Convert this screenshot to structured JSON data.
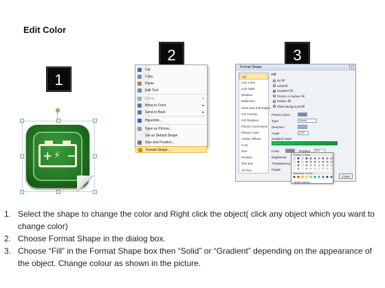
{
  "title": "Edit Color",
  "steps": [
    "1",
    "2",
    "3"
  ],
  "context_menu": {
    "items": [
      {
        "label": "Cut",
        "icon": "scissors-icon",
        "color": "#4a6fa5"
      },
      {
        "label": "Copy",
        "icon": "copy-icon",
        "color": "#6a8cc0"
      },
      {
        "label": "Paste",
        "icon": "paste-icon",
        "color": "#b08a3c"
      },
      {
        "label": "Edit Text",
        "icon": "edit-text-icon",
        "color": "#7788aa"
      },
      {
        "label": "Group",
        "icon": "group-icon",
        "color": "#aaaaaa",
        "disabled": true,
        "submenu": true
      },
      {
        "label": "Bring to Front",
        "icon": "bring-front-icon",
        "color": "#5577aa",
        "submenu": true
      },
      {
        "label": "Send to Back",
        "icon": "send-back-icon",
        "color": "#5577aa",
        "submenu": true
      },
      {
        "label": "Hyperlink...",
        "icon": "hyperlink-icon",
        "color": "#3366cc"
      },
      {
        "label": "Save as Picture...",
        "icon": "save-picture-icon",
        "color": "#999999"
      },
      {
        "label": "Set as Default Shape",
        "icon": "",
        "color": ""
      },
      {
        "label": "Size and Position...",
        "icon": "size-position-icon",
        "color": "#6677aa"
      },
      {
        "label": "Format Shape...",
        "icon": "format-shape-icon",
        "color": "#cc8833",
        "highlighted": true
      }
    ]
  },
  "dialog": {
    "title": "Format Shape",
    "close": "x",
    "categories": [
      "Fill",
      "Line Color",
      "Line Style",
      "Shadow",
      "Reflection",
      "Glow and Soft Edges",
      "3-D Format",
      "3-D Rotation",
      "Picture Corrections",
      "Picture Color",
      "Artistic Effects",
      "Crop",
      "Size",
      "Position",
      "Text Box",
      "Alt Text"
    ],
    "section": "Fill",
    "options": [
      "No fill",
      "Solid fill",
      "Gradient fill",
      "Picture or texture fill",
      "Pattern fill",
      "Slide background fill"
    ],
    "selected_option": "Gradient fill",
    "fields": {
      "preset": "Preset colors:",
      "type": "Type:",
      "type_value": "Linear",
      "direction": "Direction:",
      "angle": "Angle:",
      "angle_value": "270°",
      "stops": "Gradient stops",
      "color": "Color:",
      "position": "Position:",
      "position_value": "0%",
      "brightness": "Brightness:",
      "transparency": "Transparency:",
      "rotate": "Rotate"
    },
    "palette": {
      "theme_label": "Theme Colors",
      "standard_label": "Standard Colors",
      "more": "More Colors...",
      "theme": [
        "#ffffff",
        "#000000",
        "#eeece1",
        "#1f497d",
        "#4f81bd",
        "#c0504d",
        "#9bbb59",
        "#8064a2",
        "#4bacc6",
        "#f79646"
      ],
      "standard": [
        "#c00000",
        "#ff0000",
        "#ffc000",
        "#ffff00",
        "#92d050",
        "#00b050",
        "#00b0f0",
        "#0070c0",
        "#002060",
        "#7030a0"
      ]
    },
    "close_button": "Close"
  },
  "shape": {
    "accent": "#1d6b1d",
    "icon": "battery-icon",
    "plus": "+",
    "bolt": "⚡",
    "minus": "−"
  },
  "instructions": [
    {
      "n": "1.",
      "text": "Select the shape to change the color and Right click the object( click any object which you want to change color)"
    },
    {
      "n": "2.",
      "text": "Choose Format Shape in the dialog box."
    },
    {
      "n": "3.",
      "text": "Choose “Fill” in the Format Shape box then “Solid” or “Gradient” depending on the appearance of the object. Change colour as shown in the picture."
    }
  ]
}
